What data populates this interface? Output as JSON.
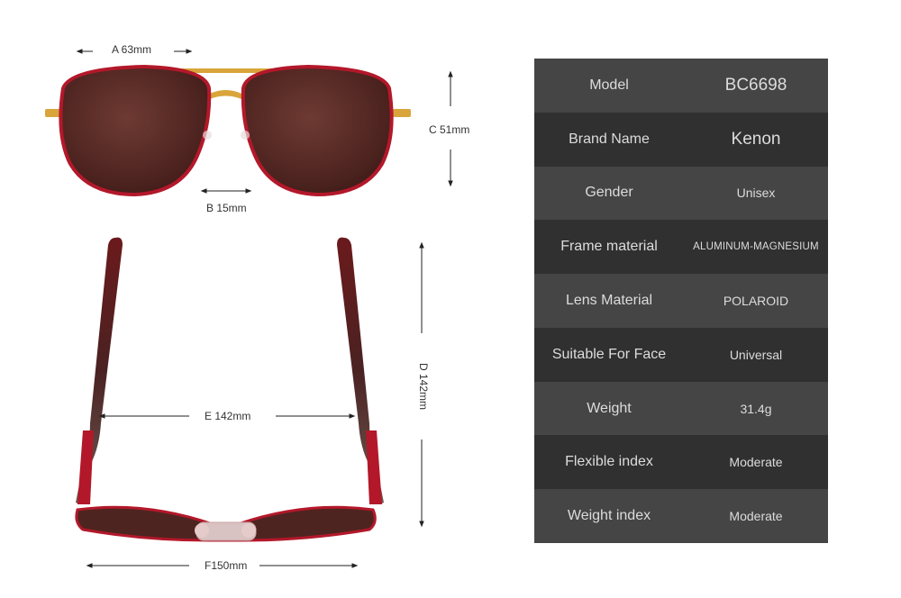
{
  "dimensions": {
    "a": "A 63mm",
    "b": "B 15mm",
    "c": "C 51mm",
    "d": "D 142mm",
    "e": "E 142mm",
    "f": "F150mm"
  },
  "specs": [
    {
      "key": "Model",
      "value": "BC6698"
    },
    {
      "key": "Brand Name",
      "value": "Kenon"
    },
    {
      "key": "Gender",
      "value": "Unisex"
    },
    {
      "key": "Frame material",
      "value": "ALUMINUM-MAGNESIUM"
    },
    {
      "key": "Lens Material",
      "value": "POLAROID"
    },
    {
      "key": "Suitable For Face",
      "value": "Universal"
    },
    {
      "key": "Weight",
      "value": "31.4g"
    },
    {
      "key": "Flexible index",
      "value": "Moderate"
    },
    {
      "key": "Weight index",
      "value": "Moderate"
    }
  ],
  "colors": {
    "frame": "#b3182a",
    "lens": "#5a2a26",
    "bridge": "#d9a53a",
    "table_light": "#454545",
    "table_dark": "#303030",
    "table_text": "#dcdcdc"
  }
}
